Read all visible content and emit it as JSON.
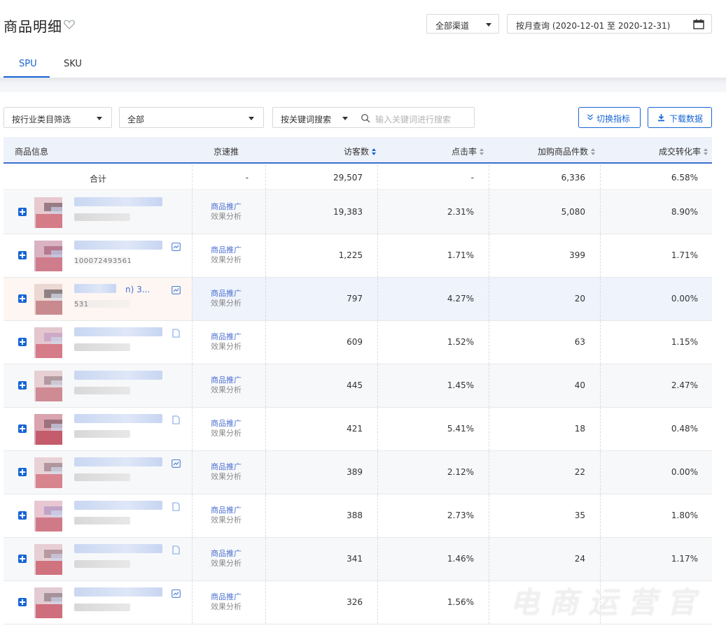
{
  "header": {
    "title": "商品明细",
    "channel_select": "全部渠道",
    "date_range": "按月查询 (2020-12-01 至 2020-12-31)"
  },
  "tabs": [
    {
      "label": "SPU",
      "active": true
    },
    {
      "label": "SKU",
      "active": false
    }
  ],
  "filters": {
    "industry_select": "按行业类目筛选",
    "category_select": "全部",
    "keyword_mode_select": "按关键词搜索",
    "search_placeholder": "输入关键词进行搜索",
    "switch_metrics_label": "切换指标",
    "download_label": "下载数据"
  },
  "table": {
    "columns": [
      "商品信息",
      "京速推",
      "访客数",
      "点击率",
      "加购商品件数",
      "成交转化率"
    ],
    "total": {
      "label": "合计",
      "jst": "-",
      "visitors": "29,507",
      "ctr": "-",
      "cart": "6,336",
      "cvr": "6.58%"
    },
    "promo_line1": "商品推广",
    "promo_line2": "效果分析",
    "rows": [
      {
        "visitors": "19,383",
        "ctr": "2.31%",
        "cart": "5,080",
        "cvr": "8.90%",
        "title_visible": "",
        "id_visible": ""
      },
      {
        "visitors": "1,225",
        "ctr": "1.71%",
        "cart": "399",
        "cvr": "1.71%",
        "title_visible": "",
        "id_visible": "100072493561"
      },
      {
        "visitors": "797",
        "ctr": "4.27%",
        "cart": "20",
        "cvr": "0.00%",
        "title_visible": "n) 3...",
        "id_visible": "531"
      },
      {
        "visitors": "609",
        "ctr": "1.52%",
        "cart": "63",
        "cvr": "1.15%",
        "title_visible": "",
        "id_visible": ""
      },
      {
        "visitors": "445",
        "ctr": "1.45%",
        "cart": "40",
        "cvr": "2.47%",
        "title_visible": "",
        "id_visible": ""
      },
      {
        "visitors": "421",
        "ctr": "5.41%",
        "cart": "18",
        "cvr": "0.48%",
        "title_visible": "",
        "id_visible": ""
      },
      {
        "visitors": "389",
        "ctr": "2.12%",
        "cart": "22",
        "cvr": "0.00%",
        "title_visible": "",
        "id_visible": ""
      },
      {
        "visitors": "388",
        "ctr": "2.73%",
        "cart": "35",
        "cvr": "1.80%",
        "title_visible": "",
        "id_visible": ""
      },
      {
        "visitors": "341",
        "ctr": "1.46%",
        "cart": "24",
        "cvr": "1.17%",
        "title_visible": "",
        "id_visible": ""
      },
      {
        "visitors": "326",
        "ctr": "1.56%",
        "cart": "",
        "cvr": "",
        "title_visible": "",
        "id_visible": ""
      }
    ]
  },
  "watermark": "电商运营官",
  "colors": {
    "accent": "#1765d6",
    "header_bg": "#eef2fa",
    "row_alt": "#f7f8fa"
  }
}
